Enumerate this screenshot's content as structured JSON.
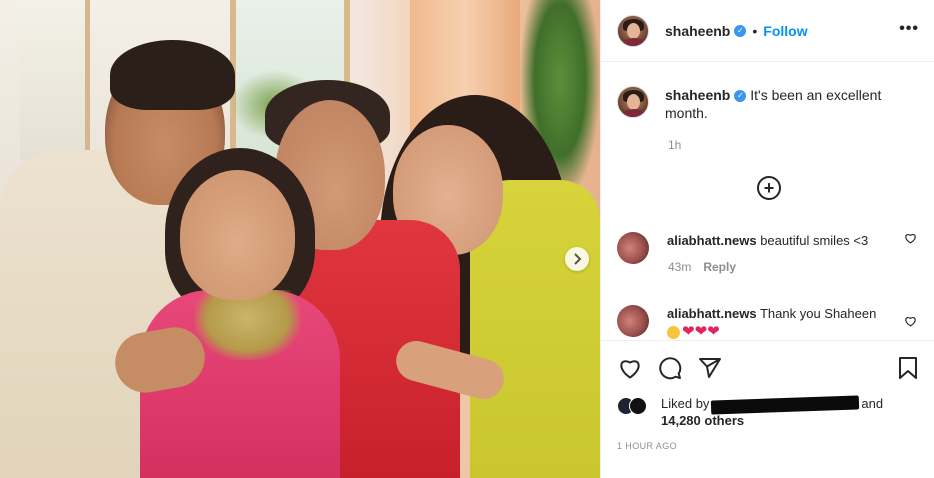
{
  "post": {
    "username": "shaheenb",
    "follow_label": "Follow",
    "dot": "•",
    "more_label": "•••",
    "caption": "It's been an excellent month.",
    "caption_time": "1h"
  },
  "comments": [
    {
      "username": "aliabhatt.news",
      "text": "beautiful smiles <3",
      "time": "43m",
      "reply_label": "Reply"
    },
    {
      "username": "aliabhatt.news",
      "text": "Thank you Shaheen"
    }
  ],
  "likes": {
    "prefix": "Liked by",
    "and": "and",
    "count_text": "14,280 others"
  },
  "timestamp": "1 HOUR AGO",
  "icons": {
    "verified": "verified-badge-icon",
    "more": "more-options-icon",
    "add": "add-circle-icon",
    "like": "heart-icon",
    "comment": "comment-icon",
    "share": "share-icon",
    "save": "bookmark-icon",
    "next": "chevron-right-icon"
  },
  "colors": {
    "accent": "#0095f6",
    "verified": "#3897f0",
    "text": "#262626",
    "muted": "#8e8e8e"
  }
}
